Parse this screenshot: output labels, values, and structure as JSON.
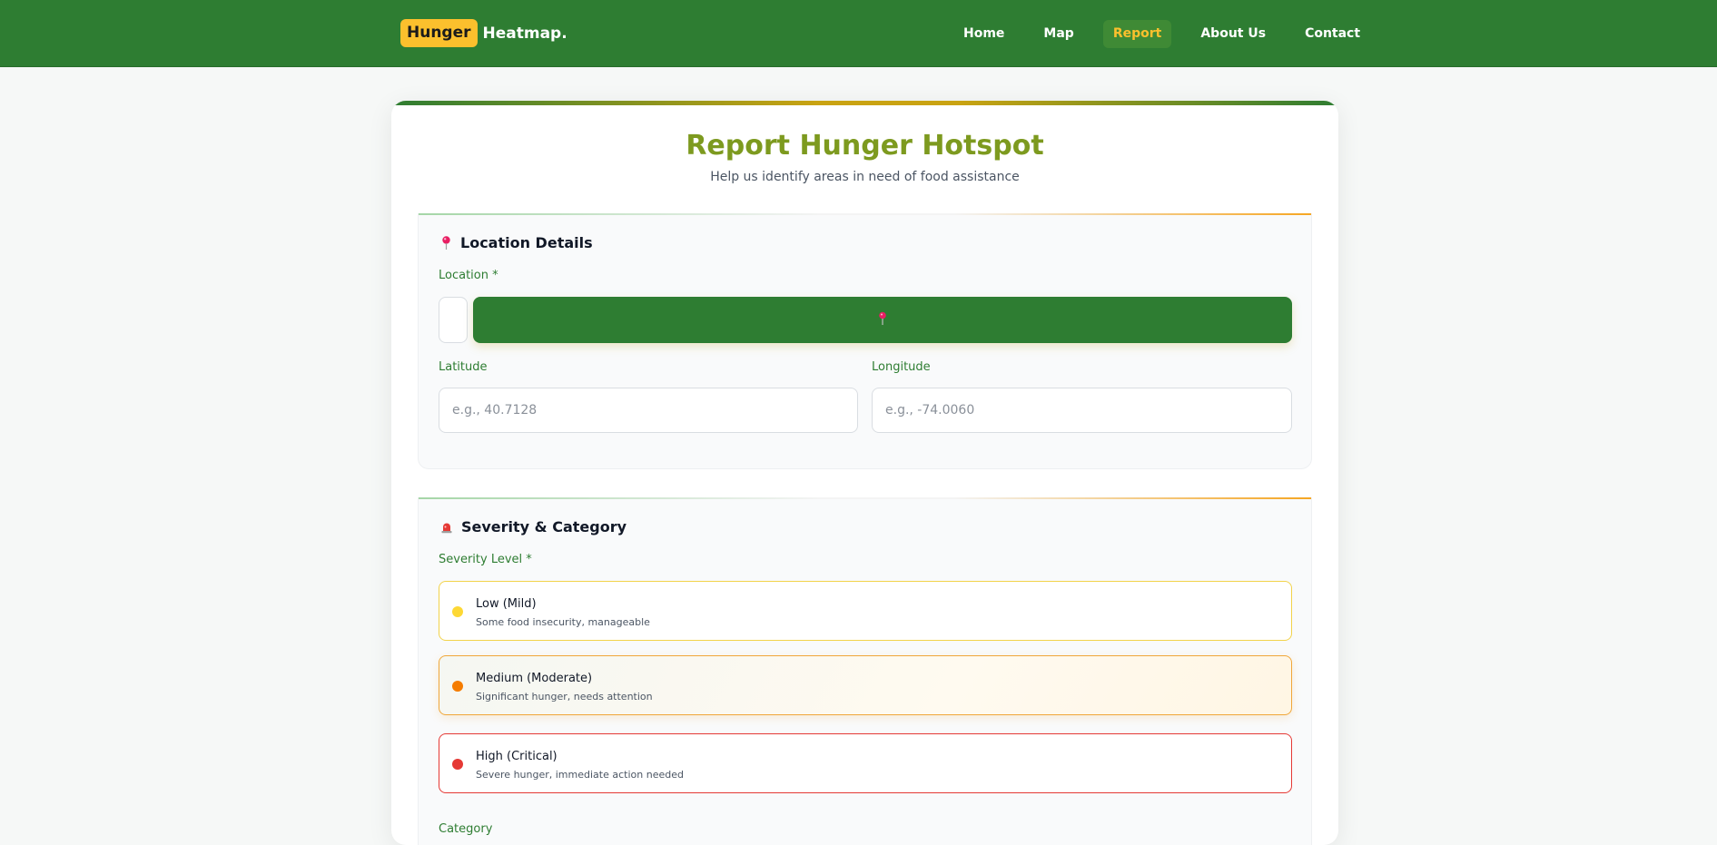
{
  "navbar": {
    "logo_badge": "Hunger",
    "logo_rest": "Heatmap.",
    "links": [
      {
        "label": "Home",
        "active": false
      },
      {
        "label": "Map",
        "active": false
      },
      {
        "label": "Report",
        "active": true
      },
      {
        "label": "About Us",
        "active": false
      },
      {
        "label": "Contact",
        "active": false
      }
    ]
  },
  "card": {
    "title": "Report Hunger Hotspot",
    "subtitle": "Help us identify areas in need of food assistance"
  },
  "location_section": {
    "heading": "Location Details",
    "icon": "pin-icon",
    "location_label": "Location *",
    "location_button_icon": "pin-icon",
    "latitude_label": "Latitude",
    "latitude_placeholder": "e.g., 40.7128",
    "longitude_label": "Longitude",
    "longitude_placeholder": "e.g., -74.0060"
  },
  "severity_section": {
    "heading": "Severity & Category",
    "icon": "alarm-light-icon",
    "severity_label": "Severity Level *",
    "options": [
      {
        "name": "Low (Mild)",
        "description": "Some food insecurity, manageable",
        "color": "#fdd835"
      },
      {
        "name": "Medium (Moderate)",
        "description": "Significant hunger, needs attention",
        "color": "#f57c00"
      },
      {
        "name": "High (Critical)",
        "description": "Severe hunger, immediate action needed",
        "color": "#e53935"
      }
    ],
    "category_label": "Category"
  },
  "colors": {
    "brand_green": "#2e7d32",
    "accent_yellow": "#fbc02d",
    "title_olive": "#7d9a1f"
  }
}
